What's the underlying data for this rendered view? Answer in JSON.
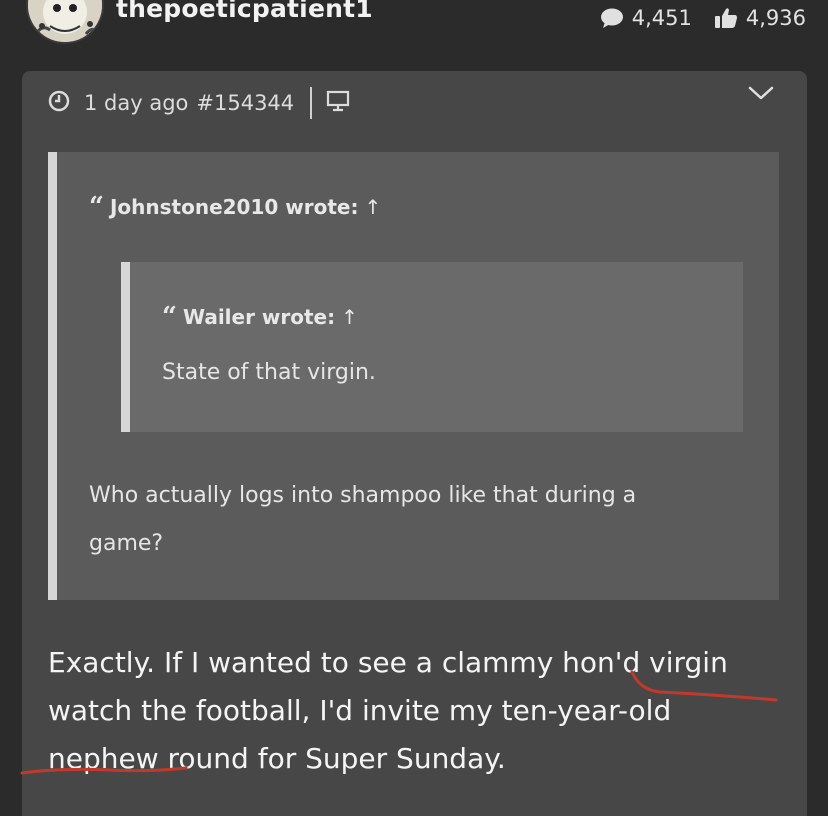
{
  "header": {
    "username": "thepoeticpatient1",
    "comments_count": "4,451",
    "likes_count": "4,936"
  },
  "post": {
    "time_ago": "1 day ago",
    "post_id": "#154344",
    "outer_quote": {
      "author_line": "Johnstone2010 wrote:",
      "arrow": "↑",
      "body": "Who actually logs into shampoo like that during a game?",
      "inner_quote": {
        "author_line": "Wailer wrote:",
        "arrow": "↑",
        "body": "State of that virgin."
      }
    },
    "reply_text": "Exactly. If I wanted to see a clammy hon'd virgin watch the football, I'd invite my ten-year-old nephew round for Super Sunday."
  },
  "icons": [
    "avatar",
    "comment-bubble-icon",
    "thumbs-up-icon",
    "clock-icon",
    "desktop-icon",
    "chevron-down-icon",
    "quote-mark-icon",
    "arrow-up-icon"
  ],
  "colors": {
    "background": "#2b2b2b",
    "card": "#474747",
    "quote_outer": "#5b5b5b",
    "quote_inner": "#6a6a6a",
    "quote_bar": "#d6d6d6",
    "scribble": "#c0392b"
  }
}
